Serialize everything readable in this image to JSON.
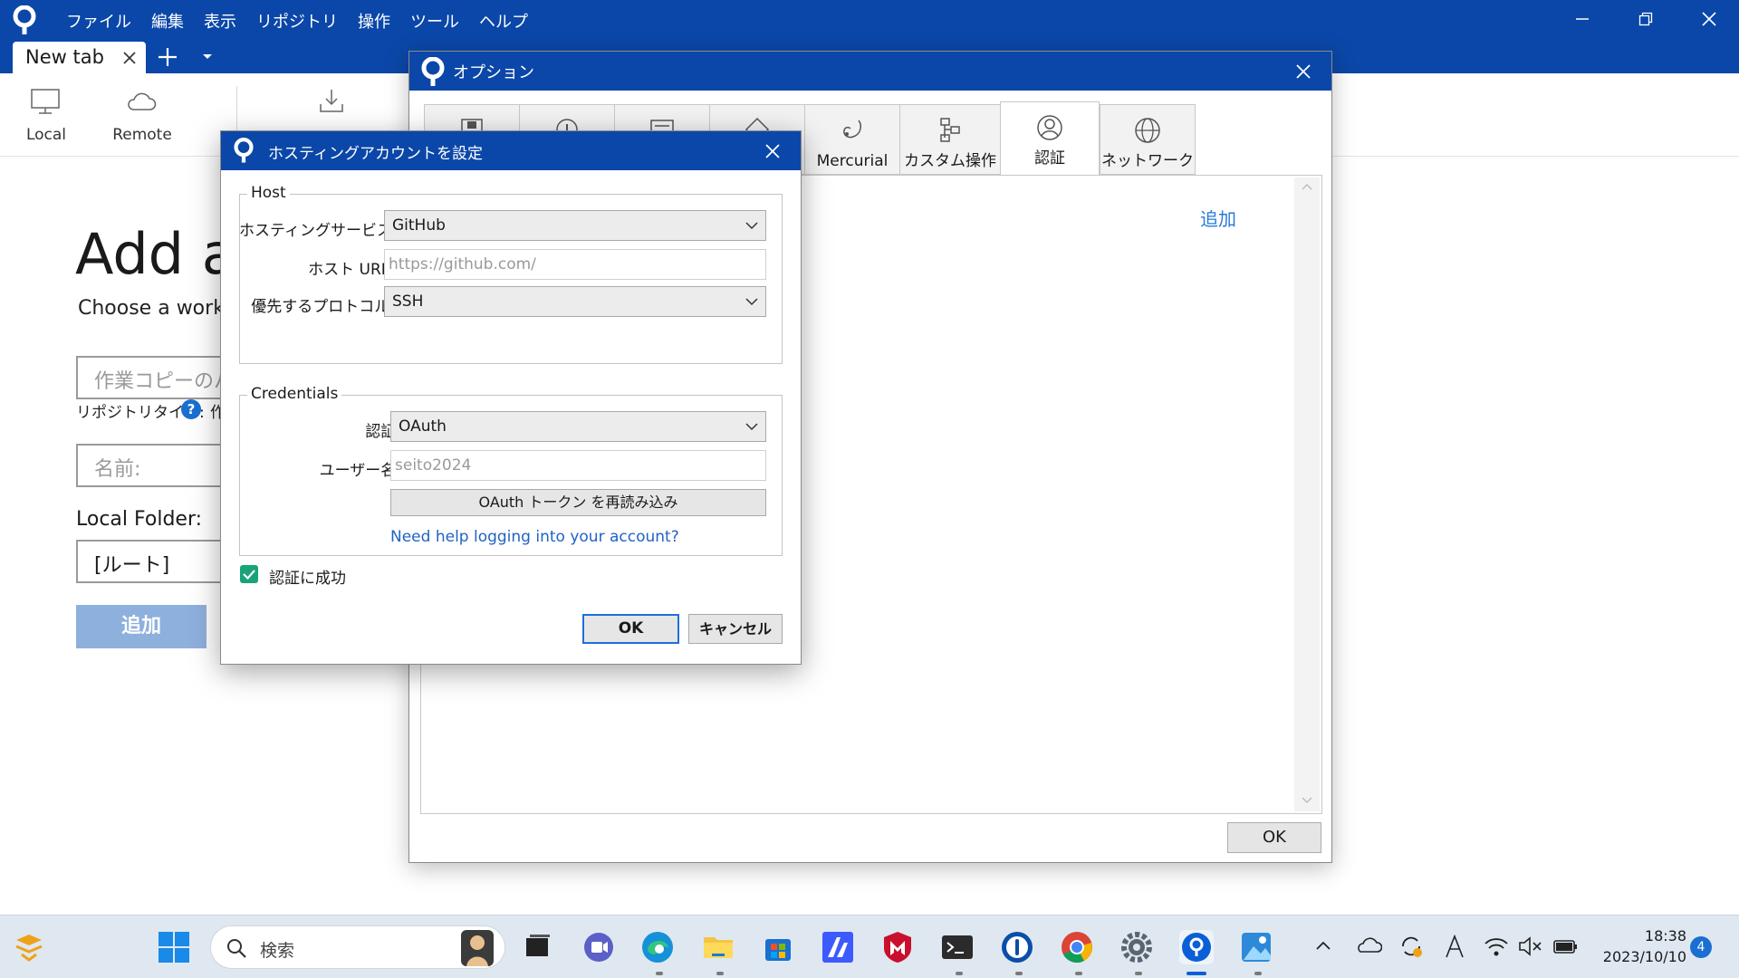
{
  "menu": [
    "ファイル",
    "編集",
    "表示",
    "リポジトリ",
    "操作",
    "ツール",
    "ヘルプ"
  ],
  "tab": {
    "label": "New tab"
  },
  "toolbar": {
    "local": "Local",
    "remote": "Remote"
  },
  "page": {
    "title": "Add a",
    "subtitle": "Choose a work",
    "path_placeholder": "作業コピーのパ",
    "repo_type_label": "リポジトリタイプ:",
    "repo_type_extra": "作",
    "name_placeholder": "名前:",
    "local_folder_label": "Local Folder:",
    "local_folder_value": "[ルート]",
    "add_button": "追加"
  },
  "options_dialog": {
    "title": "オプション",
    "tabs": [
      {
        "label": "",
        "icon": "general-icon"
      },
      {
        "label": "",
        "icon": "info-icon"
      },
      {
        "label": "",
        "icon": "window-icon"
      },
      {
        "label": "",
        "icon": "git-icon"
      },
      {
        "label": "Mercurial",
        "icon": "mercurial-icon"
      },
      {
        "label": "カスタム操作",
        "icon": "custom-actions-icon"
      },
      {
        "label": "認証",
        "icon": "user-icon"
      },
      {
        "label": "ネットワーク",
        "icon": "globe-icon"
      }
    ],
    "active_tab": "認証",
    "add_link": "追加",
    "ok_button": "OK"
  },
  "hosting_dialog": {
    "title": "ホスティングアカウントを設定",
    "host_group": "Host",
    "service_label": "ホスティングサービス:",
    "service_value": "GitHub",
    "host_url_label": "ホスト URL:",
    "host_url_value": "https://github.com/",
    "protocol_label": "優先するプロトコル:",
    "protocol_value": "SSH",
    "credentials_group": "Credentials",
    "auth_label": "認証:",
    "auth_value": "OAuth",
    "username_label": "ユーザー名:",
    "username_value": "seito2024",
    "reload_button": "OAuth トークン を再読み込み",
    "help_link": "Need help logging into your account?",
    "auth_success_label": "認証に成功",
    "auth_success_checked": true,
    "ok_button": "OK",
    "cancel_button": "キャンセル"
  },
  "taskbar": {
    "search_placeholder": "検索",
    "time": "18:38",
    "date": "2023/10/10",
    "notification_count": "4"
  },
  "colors": {
    "title_bar": "#0b47a8",
    "link": "#2a79d6",
    "checkbox": "#1aa37a",
    "add_button": "#8eb0dd"
  }
}
